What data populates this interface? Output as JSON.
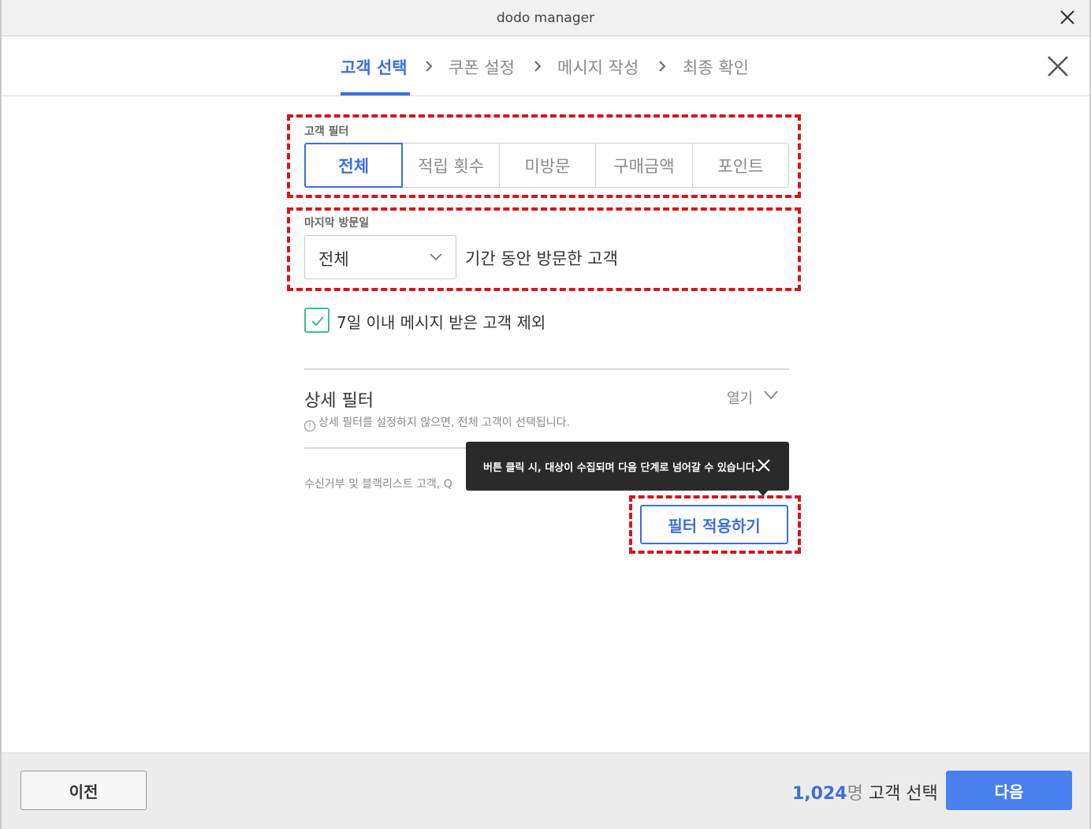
{
  "window": {
    "title": "dodo manager"
  },
  "steps": [
    {
      "label": "고객 선택",
      "active": true
    },
    {
      "label": "쿠폰 설정",
      "active": false
    },
    {
      "label": "메시지 작성",
      "active": false
    },
    {
      "label": "최종 확인",
      "active": false
    }
  ],
  "customer_filter": {
    "label": "고객 필터",
    "options": [
      "전체",
      "적립 횟수",
      "미방문",
      "구매금액",
      "포인트"
    ],
    "selected": "전체"
  },
  "last_visit": {
    "label": "마지막 방문일",
    "selected": "전체",
    "suffix": "기간 동안 방문한 고객"
  },
  "exclude_recent": {
    "label": "7일 이내 메시지 받은 고객 제외",
    "checked": true
  },
  "detail_filter": {
    "title": "상세 필터",
    "toggle_label": "열기",
    "note": "상세 필터를 설정하지 않으면, 전체 고객이 선택됩니다."
  },
  "footer_note": "수신거부 및 블랙리스트 고객, Q",
  "tooltip": {
    "text": "버튼 클릭 시, 대상이 수집되며 다음 단계로 넘어갈 수 있습니다."
  },
  "apply_button": "필터 적용하기",
  "bottom": {
    "prev_label": "이전",
    "count_value": "1,024",
    "count_unit": "명",
    "count_suffix": " 고객 선택",
    "next_label": "다음"
  },
  "colors": {
    "accent": "#3e6fd8",
    "next_button": "#4a80ee",
    "highlight_dashed": "#d8141c",
    "checkbox": "#3fbf8a",
    "tooltip_bg": "#2a2a2a"
  }
}
